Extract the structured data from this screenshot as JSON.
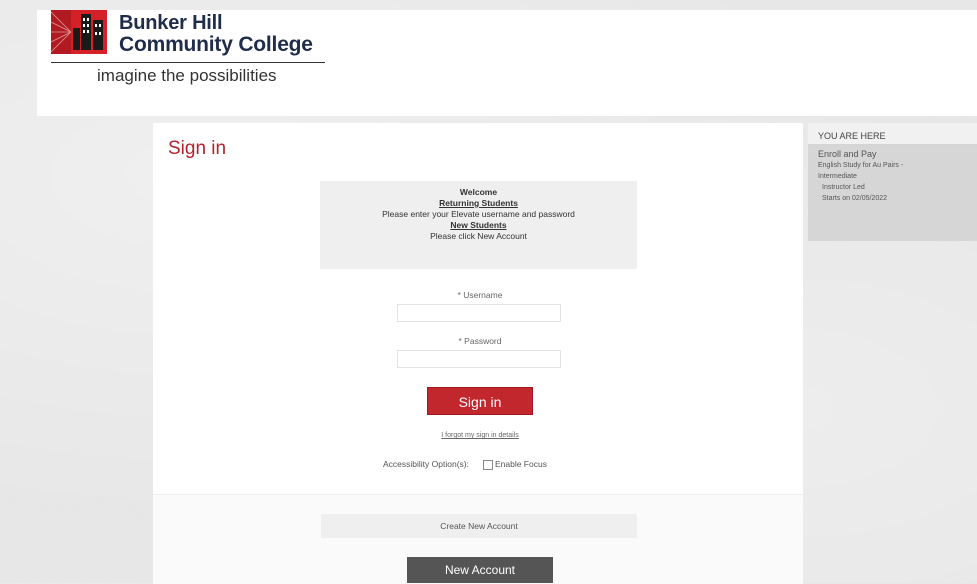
{
  "header": {
    "logo_line1": "Bunker Hill",
    "logo_line2": "Community College",
    "tagline": "imagine the possibilities"
  },
  "main": {
    "title": "Sign in",
    "welcome": {
      "heading": "Welcome",
      "returning_heading": "Returning Students",
      "returning_text": "Please enter your Elevate username and password",
      "new_heading": "New Students",
      "new_text": "Please click New Account"
    },
    "username_label": "* Username",
    "username_value": "",
    "password_label": "* Password",
    "password_value": "",
    "signin_label": "Sign in",
    "forgot_label": "I forgot my sign in details",
    "accessibility_label": "Accessibility Option(s):",
    "enable_focus_label": "Enable Focus",
    "create_heading": "Create New Account",
    "new_account_label": "New Account"
  },
  "sidebar": {
    "title": "YOU ARE HERE",
    "step": "Enroll and Pay",
    "course": "English Study for Au Pairs -",
    "level": "Intermediate",
    "format": "Instructor Led",
    "starts": "Starts on 02/05/2022"
  },
  "colors": {
    "accent": "#c1272d",
    "title": "#b2222a",
    "brand_navy": "#1f2d49",
    "button_dark": "#555555"
  }
}
